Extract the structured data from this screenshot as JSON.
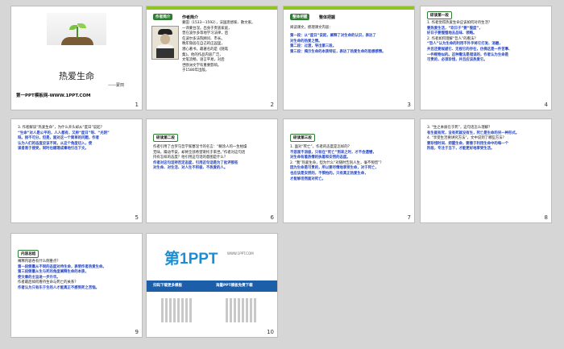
{
  "slides": [
    {
      "num": "1",
      "title": "热爱生命",
      "author": "——蒙田",
      "footer": "第一PPT模板网-WWW.1PPT.COM"
    },
    {
      "num": "2",
      "tag": "作者简介",
      "heading": "作者简介",
      "lines": [
        "蒙田（1533—1592），法国思想家、散文家。",
        "一译蒙台涅。出身于贵族家庭，",
        "曾在波尔多等地学习法律，后",
        "任波尔多法院顾问、市长。",
        "晚年隐居在自己的庄园里，",
        "潜心著书，最著名的是《随笔",
        "集》。他的作品内容广泛，",
        "文笔流畅，语言平易，对后",
        "世欧洲文学有重要影响。",
        "于1580年出版。"
      ]
    },
    {
      "num": "3",
      "tag": "整体把握",
      "heading": "整体把握",
      "intro": "阅读课文，梳理课文内容：",
      "lines": [
        "第一段：从“度日”说起，阐释了对生命的认识，表达了",
        "对生命的热爱之情。",
        "第二段：过渡，导出第三段。",
        "第三段：揭示生命的本质特征，表达了热爱生命的思想感情。"
      ]
    },
    {
      "num": "4",
      "heading": "研读第一段",
      "lines": [
        "1. 作者觉得热爱生命应该如何对待生活？",
        "要热爱生活，“欢日子”要“慢度”，",
        "好日子要慢慢地去品味、领略。",
        "2. 作者如何理解“哲人”的看法？",
        "“哲人”认为生命的利用不外乎将它打发、消磨，",
        "并且还要规避它、无视它的存在，仿佛这是一件苦事、",
        "一件贱物似的。这种看法是错误的，作者认为生命是",
        "可贵的，必须珍惜，并且应该热爱它。"
      ]
    },
    {
      "num": "5",
      "lines": [
        "3. 作者解读“热爱生命”，为什么开头却从“度日”说起？",
        "“生命”对人是公平的，人人都有，又称“度日”呀、“光阴”",
        "呀。按不可分，但是，面对这一个简单的问题，作者",
        "认为人们的态度应该不同，从这个角度切入，使",
        "读者易于接受，同时也顺理成章地引出下文。"
      ]
    },
    {
      "num": "6",
      "heading": "研读第二段",
      "lines": [
        "作者引用了古罗马哲学家塞涅卡的名言：“糊涂人的一生枯燥",
        "无味，躁动不安，却将全部希望寄托于来世。”作者对这句话",
        "持有怎样的态度？他引用这句话的意图是什么？",
        "作者对这句话持否定态度，引用这句话是为了批评那些",
        "对生命、对生活、对人生不积极、不热爱的人。"
      ]
    },
    {
      "num": "7",
      "heading": "研读第三段",
      "lines": [
        "1. 面对“死亡”，作者的态度是怎样的？",
        "不悲观不消极，只有在“死亡”到来之时，才不会遗憾，",
        "对生命有着热情的执着和安然的态度。",
        "2. “我”热爱生命，但为什么“对随时告别人生，毫不惋惜”？",
        "因为生命是可贵的，所以要尽情地享受生命，对于死亡，",
        "也应该是安然的，不惧怕的。只有真正热爱生命，",
        "才能够坦然面对死亡。"
      ]
    },
    {
      "num": "8",
      "lines": [
        "3. “生之本质在于死”，这句话怎么理解？",
        "有生就有死，没有死就没有生，死亡是生命的另一种形式。",
        "4. “享受生活要讲究方法”，文中说到了哪些方法？",
        "要珍惜时间、把握生命，要善于利用生命中的每一个",
        "阶段，专注于当下，才能更好地享受生活。"
      ]
    },
    {
      "num": "9",
      "heading": "内容总结",
      "lines": [
        "阐释内容各有什么侧重点？",
        "第一段侧重从不同的态度对待生命，表明作者热爱生命。",
        "第三段侧重从生与死的角度阐释生命的本质，",
        "使文章的主旨进一步升华。",
        "作者最后如何看待生命与死亡的关系？",
        "作者认为只有乐于生的人才能真正不感到死之苦恼。"
      ]
    },
    {
      "num": "10",
      "logo": "第1PPT",
      "logo_sub": "WWW.1PPT.COM",
      "bar_left": "扫码下载更多模板",
      "bar_right": "海量PPT模板免费下载"
    }
  ]
}
